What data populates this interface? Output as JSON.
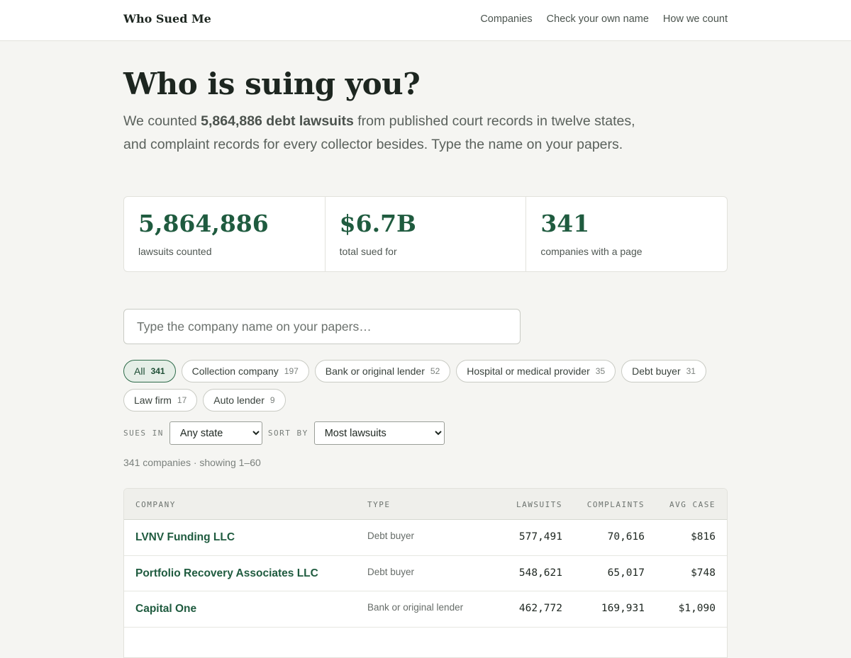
{
  "brand": "Who Sued Me",
  "nav": [
    "Companies",
    "Check your own name",
    "How we count"
  ],
  "headline": "Who is suing you?",
  "intro": {
    "before": "We counted ",
    "bold": "5,864,886 debt lawsuits",
    "after": " from published court records in twelve states, and complaint records for every collector besides. Type the name on your papers."
  },
  "stats": [
    {
      "value": "5,864,886",
      "label": "lawsuits counted"
    },
    {
      "value": "$6.7B",
      "label": "total sued for"
    },
    {
      "value": "341",
      "label": "companies with a page"
    }
  ],
  "search": {
    "placeholder": "Type the company name on your papers…",
    "value": ""
  },
  "chips": [
    {
      "label": "All",
      "count": "341",
      "active": true
    },
    {
      "label": "Collection company",
      "count": "197",
      "active": false
    },
    {
      "label": "Bank or original lender",
      "count": "52",
      "active": false
    },
    {
      "label": "Hospital or medical provider",
      "count": "35",
      "active": false
    },
    {
      "label": "Debt buyer",
      "count": "31",
      "active": false
    },
    {
      "label": "Law firm",
      "count": "17",
      "active": false
    },
    {
      "label": "Auto lender",
      "count": "9",
      "active": false
    }
  ],
  "filters": {
    "state_label": "SUES IN",
    "state_value": "Any state",
    "sort_label": "SORT BY",
    "sort_value": "Most lawsuits"
  },
  "showing": "341 companies · showing 1–60",
  "table": {
    "headers": {
      "company": "COMPANY",
      "type": "TYPE",
      "lawsuits": "LAWSUITS",
      "complaints": "COMPLAINTS",
      "avg": "AVG CASE"
    },
    "rows": [
      {
        "company": "LVNV Funding LLC",
        "type": "Debt buyer",
        "lawsuits": "577,491",
        "complaints": "70,616",
        "avg": "$816"
      },
      {
        "company": "Portfolio Recovery Associates LLC",
        "type": "Debt buyer",
        "lawsuits": "548,621",
        "complaints": "65,017",
        "avg": "$748"
      },
      {
        "company": "Capital One",
        "type": "Bank or original lender",
        "lawsuits": "462,772",
        "complaints": "169,931",
        "avg": "$1,090"
      },
      {
        "company": "",
        "type": "",
        "lawsuits": "",
        "complaints": "",
        "avg": ""
      }
    ]
  },
  "colors": {
    "accent": "#1f5b3f",
    "background": "#f5f5f2",
    "active_chip": "#e5eee7"
  }
}
